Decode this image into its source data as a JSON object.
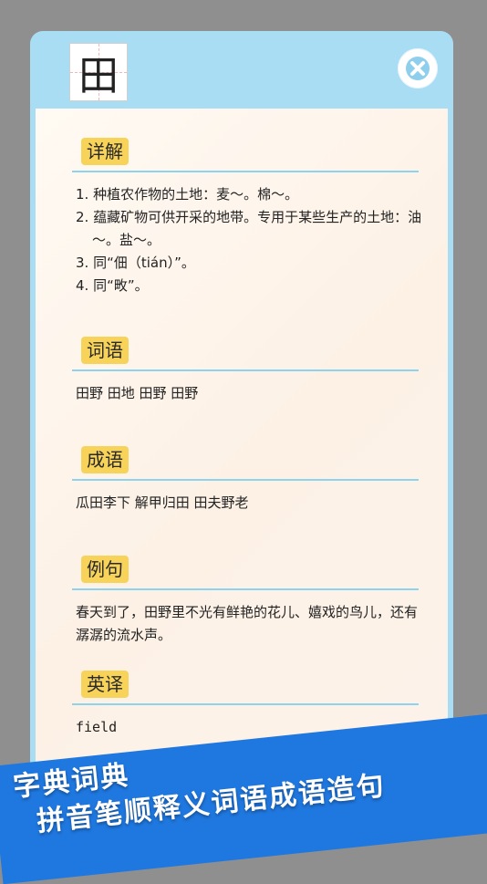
{
  "header": {
    "character": "田"
  },
  "sections": {
    "detail": {
      "title": "详解",
      "items": [
        "1. 种植农作物的土地：麦～。棉～。",
        "2. 蕴藏矿物可供开采的地带。专用于某些生产的土地：油～。盐～。",
        "3. 同“佃（tián）”。",
        "4. 同“畋”。"
      ]
    },
    "words": {
      "title": "词语",
      "text": "田野  田地  田野  田野"
    },
    "idioms": {
      "title": "成语",
      "text": "瓜田李下   解甲归田   田夫野老"
    },
    "example": {
      "title": "例句",
      "text": "春天到了，田野里不光有鲜艳的花儿、嬉戏的鸟儿，还有潺潺的流水声。"
    },
    "english": {
      "title": "英译",
      "text": "field"
    }
  },
  "banner": {
    "line1": "字典词典",
    "line2": "拼音笔顺释义词语成语造句"
  }
}
